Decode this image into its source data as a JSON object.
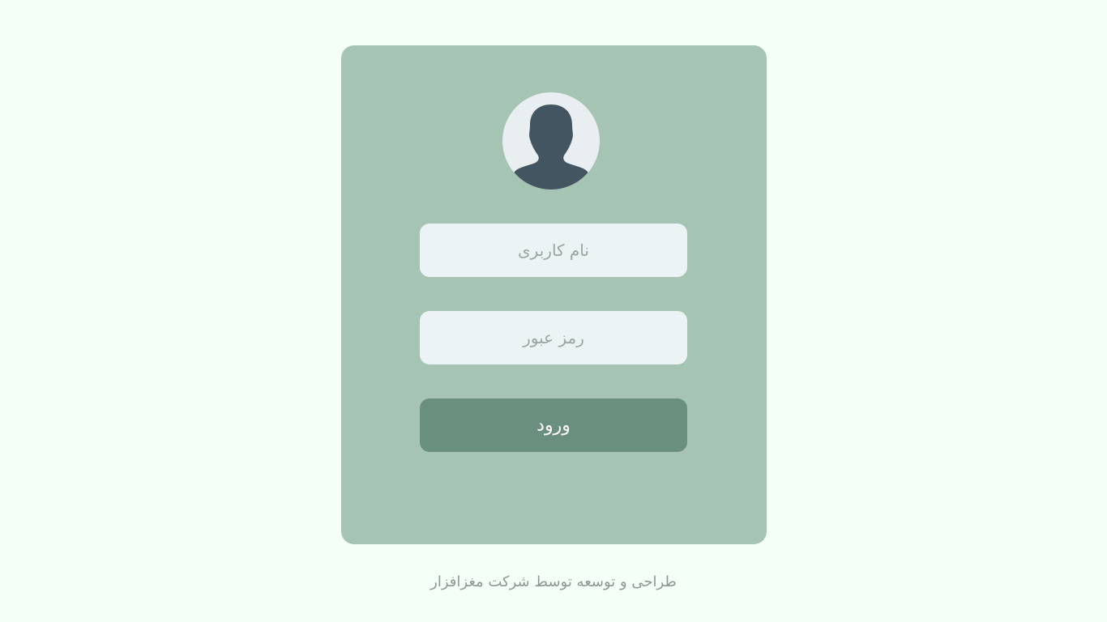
{
  "login": {
    "avatar_icon": "user-silhouette-icon",
    "username": {
      "value": "",
      "placeholder": "نام کاربری"
    },
    "password": {
      "value": "",
      "placeholder": "رمز عبور"
    },
    "submit_label": "ورود"
  },
  "footer": {
    "credit": "طراحی و توسعه توسط شرکت مغزافزار"
  },
  "colors": {
    "page_background": "#f4fff7",
    "card_background": "#a6c4b4",
    "input_background": "#ebf3f4",
    "button_background": "#6b8f7e",
    "avatar_silhouette": "#435560"
  }
}
